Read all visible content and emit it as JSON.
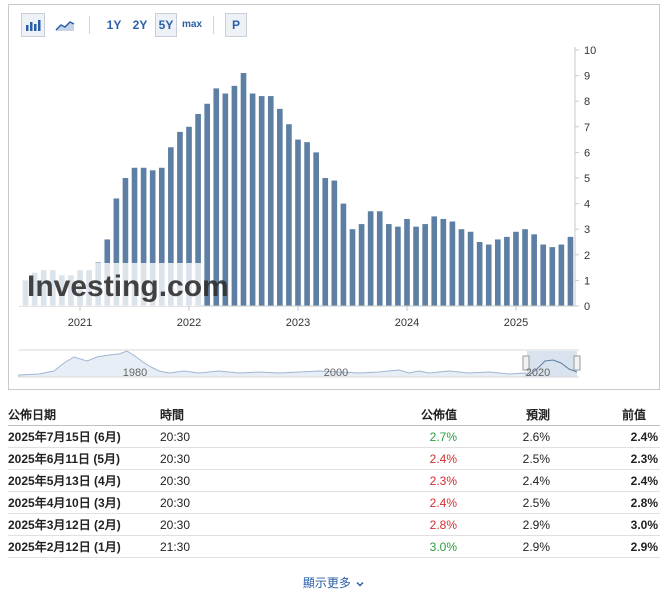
{
  "toolbar": {
    "ranges": [
      "1Y",
      "2Y",
      "5Y",
      "max"
    ],
    "active_range": "5Y",
    "p_label": "P",
    "bar_chart_icon": "bar-chart-icon",
    "area_chart_icon": "area-chart-icon"
  },
  "watermark": "Investing.com",
  "navigator": {
    "year_labels": [
      "1980",
      "2000",
      "2020"
    ]
  },
  "chart_data": {
    "type": "bar",
    "x_labels": [
      "2021",
      "2022",
      "2023",
      "2024",
      "2025"
    ],
    "ylim": [
      0,
      10
    ],
    "y_ticks": [
      "0",
      "1",
      "2",
      "3",
      "4",
      "5",
      "6",
      "7",
      "8",
      "9",
      "10"
    ],
    "start": "2020-07",
    "values": [
      1.0,
      1.3,
      1.4,
      1.4,
      1.2,
      1.2,
      1.4,
      1.4,
      1.7,
      2.6,
      4.2,
      5.0,
      5.4,
      5.4,
      5.3,
      5.4,
      6.2,
      6.8,
      7.0,
      7.5,
      7.9,
      8.5,
      8.3,
      8.6,
      9.1,
      8.3,
      8.2,
      8.2,
      7.7,
      7.1,
      6.5,
      6.4,
      6.0,
      5.0,
      4.9,
      4.0,
      3.0,
      3.2,
      3.7,
      3.7,
      3.2,
      3.1,
      3.4,
      3.1,
      3.2,
      3.5,
      3.4,
      3.3,
      3.0,
      2.9,
      2.5,
      2.4,
      2.6,
      2.7,
      2.9,
      3.0,
      2.8,
      2.4,
      2.3,
      2.4,
      2.7
    ],
    "bar_color": "#5c7fa3",
    "grid": false,
    "yaxis_position": "right"
  },
  "table": {
    "headers": {
      "date": "公佈日期",
      "time": "時間",
      "actual": "公佈值",
      "forecast": "預測",
      "previous": "前值"
    },
    "rows": [
      {
        "date": "2025年7月15日 (6月)",
        "time": "20:30",
        "actual": "2.7%",
        "actual_color": "#2a9d3c",
        "forecast": "2.6%",
        "previous": "2.4%"
      },
      {
        "date": "2025年6月11日 (5月)",
        "time": "20:30",
        "actual": "2.4%",
        "actual_color": "#d32f2f",
        "forecast": "2.5%",
        "previous": "2.3%"
      },
      {
        "date": "2025年5月13日 (4月)",
        "time": "20:30",
        "actual": "2.3%",
        "actual_color": "#d32f2f",
        "forecast": "2.4%",
        "previous": "2.4%"
      },
      {
        "date": "2025年4月10日 (3月)",
        "time": "20:30",
        "actual": "2.4%",
        "actual_color": "#d32f2f",
        "forecast": "2.5%",
        "previous": "2.8%"
      },
      {
        "date": "2025年3月12日 (2月)",
        "time": "20:30",
        "actual": "2.8%",
        "actual_color": "#d32f2f",
        "forecast": "2.9%",
        "previous": "3.0%"
      },
      {
        "date": "2025年2月12日 (1月)",
        "time": "21:30",
        "actual": "3.0%",
        "actual_color": "#2a9d3c",
        "forecast": "2.9%",
        "previous": "2.9%"
      }
    ]
  },
  "show_more": {
    "label": "顯示更多",
    "icon": "chevron-down-icon"
  }
}
